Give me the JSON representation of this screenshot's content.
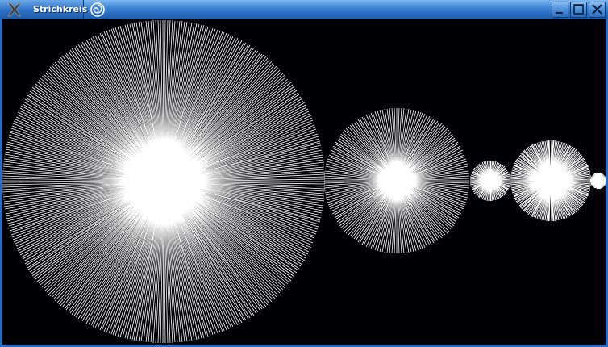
{
  "window": {
    "title": "Strichkreis"
  },
  "icons": {
    "app": "x-window-icon",
    "desktop": "swirl-icon",
    "minimize": "minimize-icon",
    "maximize": "maximize-icon",
    "close": "close-icon"
  },
  "colors": {
    "canvas_background": "#000005",
    "stroke": "#ffffff",
    "titlebar": "#2a6cc0"
  }
}
